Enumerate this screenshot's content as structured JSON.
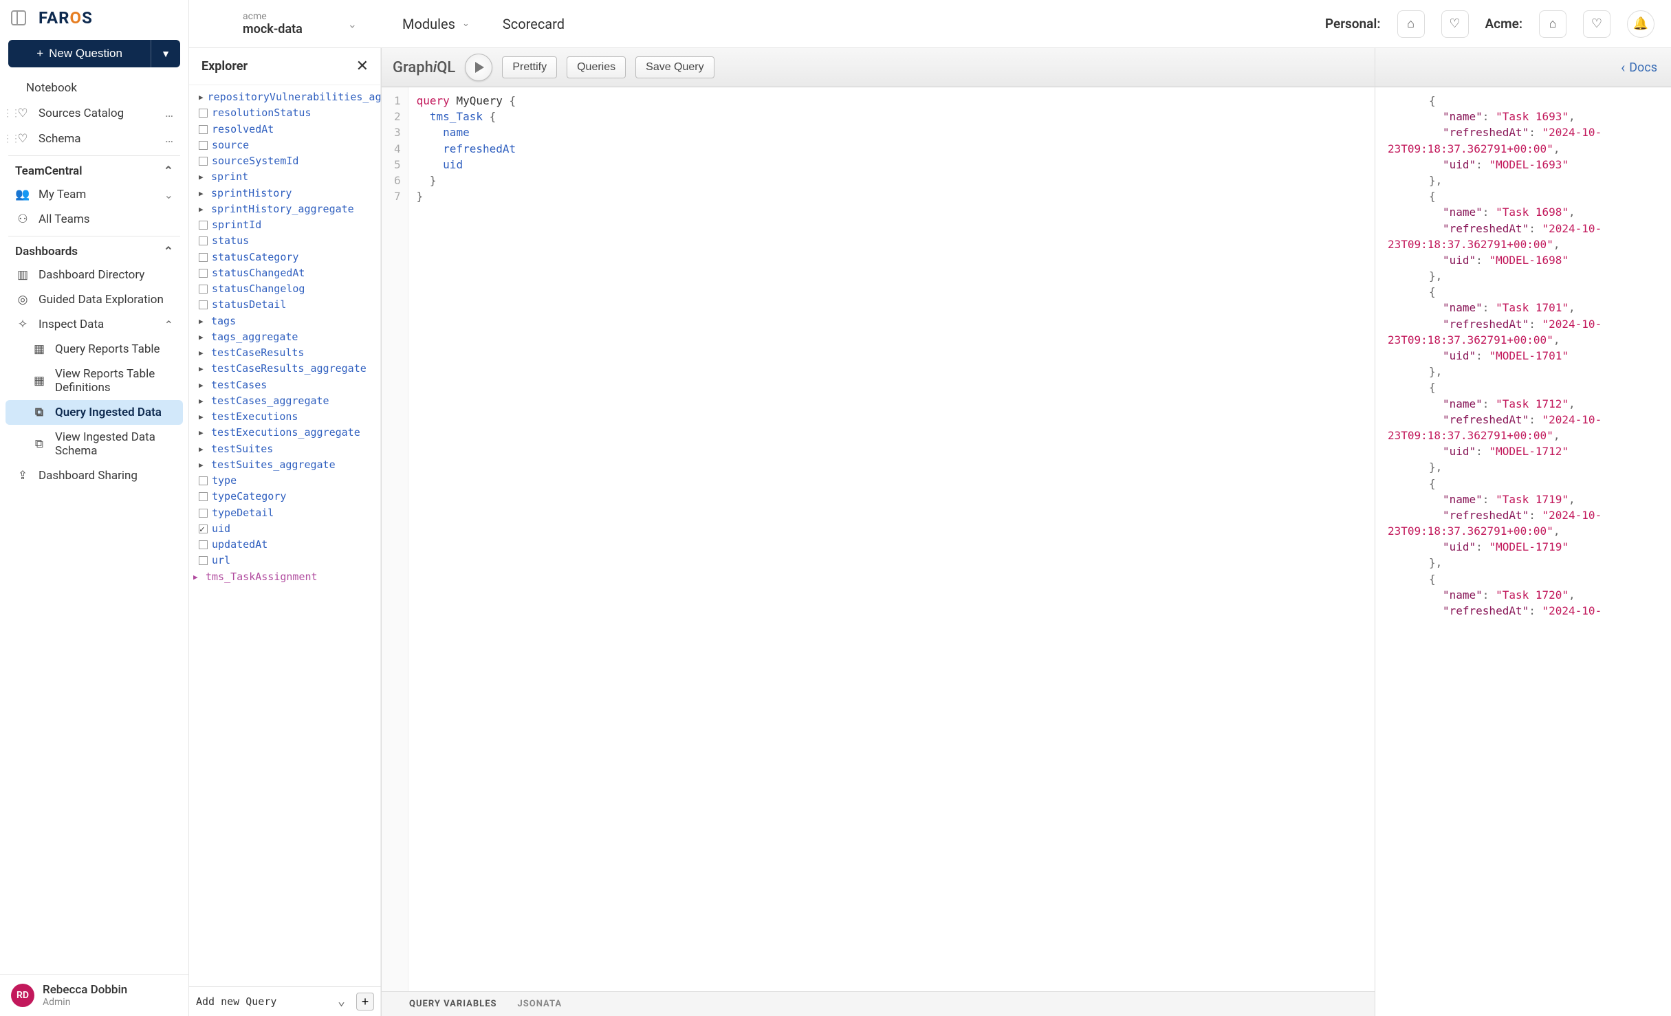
{
  "logo": "FAROS",
  "newQuestion": "New Question",
  "sidebar": {
    "notebook": "Notebook",
    "sourcesCatalog": "Sources Catalog",
    "schema": "Schema",
    "teamCentral": "TeamCentral",
    "myTeam": "My Team",
    "allTeams": "All Teams",
    "dashboards": "Dashboards",
    "dashboardDirectory": "Dashboard Directory",
    "guidedData": "Guided Data Exploration",
    "inspectData": "Inspect Data",
    "queryReports": "Query Reports Table",
    "viewReportsDef": "View Reports Table Definitions",
    "queryIngested": "Query Ingested Data",
    "viewIngestedSchema": "View Ingested Data Schema",
    "dashboardSharing": "Dashboard Sharing"
  },
  "user": {
    "initials": "RD",
    "name": "Rebecca Dobbin",
    "role": "Admin"
  },
  "topbar": {
    "orgSmall": "acme",
    "orgLarge": "mock-data",
    "modules": "Modules",
    "scorecard": "Scorecard",
    "personal": "Personal:",
    "acme": "Acme:"
  },
  "explorer": {
    "title": "Explorer",
    "rootType": "tms_TaskAssignment",
    "addNew": "Add new Query",
    "fields": [
      {
        "name": "repositoryVulnerabilities_aggregate",
        "kind": "obj"
      },
      {
        "name": "resolutionStatus",
        "kind": "scalar"
      },
      {
        "name": "resolvedAt",
        "kind": "scalar"
      },
      {
        "name": "source",
        "kind": "scalar"
      },
      {
        "name": "sourceSystemId",
        "kind": "scalar"
      },
      {
        "name": "sprint",
        "kind": "obj"
      },
      {
        "name": "sprintHistory",
        "kind": "obj"
      },
      {
        "name": "sprintHistory_aggregate",
        "kind": "obj"
      },
      {
        "name": "sprintId",
        "kind": "scalar"
      },
      {
        "name": "status",
        "kind": "scalar"
      },
      {
        "name": "statusCategory",
        "kind": "scalar"
      },
      {
        "name": "statusChangedAt",
        "kind": "scalar"
      },
      {
        "name": "statusChangelog",
        "kind": "scalar"
      },
      {
        "name": "statusDetail",
        "kind": "scalar"
      },
      {
        "name": "tags",
        "kind": "obj"
      },
      {
        "name": "tags_aggregate",
        "kind": "obj"
      },
      {
        "name": "testCaseResults",
        "kind": "obj"
      },
      {
        "name": "testCaseResults_aggregate",
        "kind": "obj"
      },
      {
        "name": "testCases",
        "kind": "obj"
      },
      {
        "name": "testCases_aggregate",
        "kind": "obj"
      },
      {
        "name": "testExecutions",
        "kind": "obj"
      },
      {
        "name": "testExecutions_aggregate",
        "kind": "obj"
      },
      {
        "name": "testSuites",
        "kind": "obj"
      },
      {
        "name": "testSuites_aggregate",
        "kind": "obj"
      },
      {
        "name": "type",
        "kind": "scalar"
      },
      {
        "name": "typeCategory",
        "kind": "scalar"
      },
      {
        "name": "typeDetail",
        "kind": "scalar"
      },
      {
        "name": "uid",
        "kind": "scalar",
        "checked": true
      },
      {
        "name": "updatedAt",
        "kind": "scalar"
      },
      {
        "name": "url",
        "kind": "scalar"
      }
    ]
  },
  "graphiql": {
    "logo": "GraphiQL",
    "prettify": "Prettify",
    "queries": "Queries",
    "saveQuery": "Save Query",
    "docs": "Docs",
    "queryVariables": "QUERY VARIABLES",
    "jsonata": "JSONATA"
  },
  "query": {
    "lines": [
      {
        "n": 1,
        "tokens": [
          [
            "kw-def",
            "query "
          ],
          [
            "kw-name",
            "MyQuery "
          ],
          [
            "brace",
            "{"
          ]
        ]
      },
      {
        "n": 2,
        "tokens": [
          [
            "plain",
            "  "
          ],
          [
            "kw-field",
            "tms_Task "
          ],
          [
            "brace",
            "{"
          ]
        ]
      },
      {
        "n": 3,
        "tokens": [
          [
            "plain",
            "    "
          ],
          [
            "kw-field",
            "name"
          ]
        ]
      },
      {
        "n": 4,
        "tokens": [
          [
            "plain",
            "    "
          ],
          [
            "kw-field",
            "refreshedAt"
          ]
        ]
      },
      {
        "n": 5,
        "tokens": [
          [
            "plain",
            "    "
          ],
          [
            "kw-field",
            "uid"
          ]
        ]
      },
      {
        "n": 6,
        "tokens": [
          [
            "plain",
            "  "
          ],
          [
            "brace",
            "}"
          ]
        ]
      },
      {
        "n": 7,
        "tokens": [
          [
            "brace",
            "}"
          ]
        ]
      }
    ]
  },
  "results": [
    {
      "name": "Task 1693",
      "refreshedAt": "2024-10-23T09:18:37.362791+00:00",
      "uid": "MODEL-1693"
    },
    {
      "name": "Task 1698",
      "refreshedAt": "2024-10-23T09:18:37.362791+00:00",
      "uid": "MODEL-1698"
    },
    {
      "name": "Task 1701",
      "refreshedAt": "2024-10-23T09:18:37.362791+00:00",
      "uid": "MODEL-1701"
    },
    {
      "name": "Task 1712",
      "refreshedAt": "2024-10-23T09:18:37.362791+00:00",
      "uid": "MODEL-1712"
    },
    {
      "name": "Task 1719",
      "refreshedAt": "2024-10-23T09:18:37.362791+00:00",
      "uid": "MODEL-1719"
    },
    {
      "name": "Task 1720",
      "refreshedAt": "2024-10-",
      "uid": "",
      "partial": true
    }
  ]
}
